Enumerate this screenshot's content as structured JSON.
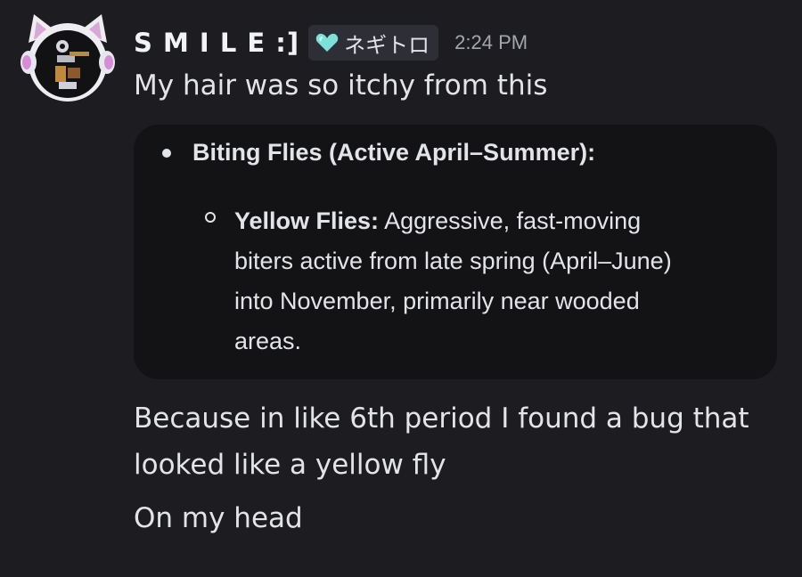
{
  "author": {
    "username": "S M I L E :]",
    "tag": {
      "icon": "heart-icon",
      "label": "ネギトロ",
      "color": "#7fe0d9"
    },
    "timestamp": "2:24 PM"
  },
  "messages": {
    "first": "My hair was so itchy from this",
    "embed": {
      "bullet_title": "Biting Flies (Active April–Summer):",
      "sub_term": "Yellow Flies:",
      "sub_line1": " Aggressive, fast-moving",
      "sub_line2": "biters active from late spring (April–June)",
      "sub_line3": "into November, primarily near wooded",
      "sub_line4": "areas."
    },
    "second_line1": "Because in like 6th period I found a bug that",
    "second_line2": "looked like a yellow fly",
    "third": "On my head"
  },
  "colors": {
    "background": "#1c1c21",
    "embed_background": "#131316",
    "text": "#e3e4e8",
    "timestamp": "#a4a6ad",
    "tag_background": "#2e2f36"
  }
}
